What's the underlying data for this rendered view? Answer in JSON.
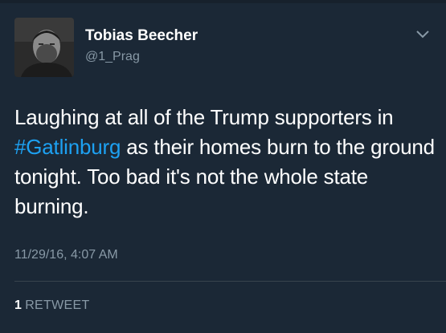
{
  "user": {
    "display_name": "Tobias Beecher",
    "handle": "@1_Prag",
    "avatar_icon": "profile-photo"
  },
  "tweet": {
    "text_before": "Laughing at all of the Trump supporters in ",
    "hashtag": "#Gatlinburg",
    "text_after": " as their homes burn to the ground tonight. Too bad it's not the whole state burning.",
    "timestamp": "11/29/16, 4:07 AM"
  },
  "stats": {
    "retweet_count": "1",
    "retweet_label": "RETWEET"
  },
  "icons": {
    "menu": "chevron-down-icon"
  },
  "colors": {
    "background": "#1b2836",
    "link": "#1da1f2",
    "secondary_text": "#8899a6"
  }
}
